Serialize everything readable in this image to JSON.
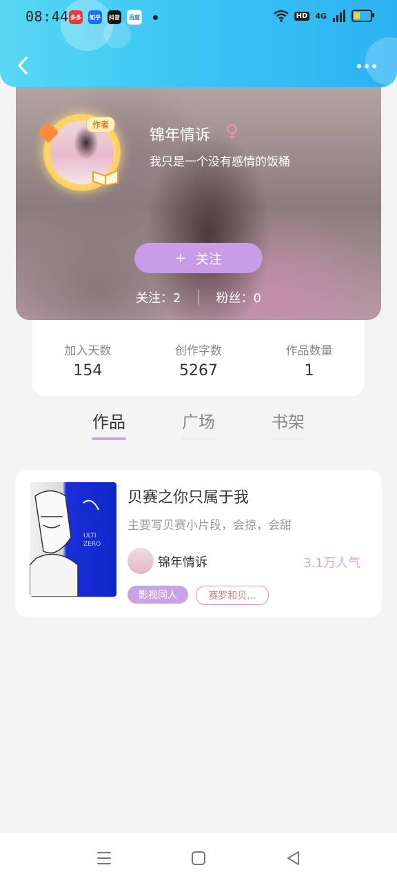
{
  "status_bar": {
    "time": "08:44",
    "notifications": [
      "多多",
      "知乎",
      "抖音",
      "百度"
    ],
    "network": "4G",
    "hd": "HD"
  },
  "header": {
    "back_icon": "chevron-left-icon",
    "more_icon": "more-horizontal-icon"
  },
  "profile": {
    "author_badge": "作者",
    "username": "锦年情诉",
    "gender_symbol": "♀",
    "bio": "我只是一个没有感情的饭桶",
    "follow_plus": "+",
    "follow_label": "关注",
    "following_label": "关注：",
    "following_count": "2",
    "fans_label": "粉丝：",
    "fans_count": "0"
  },
  "counters": [
    {
      "label": "加入天数",
      "value": "154"
    },
    {
      "label": "创作字数",
      "value": "5267"
    },
    {
      "label": "作品数量",
      "value": "1"
    }
  ],
  "tabs": [
    {
      "label": "作品",
      "active": true
    },
    {
      "label": "广场",
      "active": false
    },
    {
      "label": "书架",
      "active": false
    }
  ],
  "book": {
    "title": "贝赛之你只属于我",
    "description": "主要写贝赛小片段，会掠，会甜",
    "author": "锦年情诉",
    "popularity": "3.1万人气",
    "tags": [
      "影视同人",
      "赛罗和贝..."
    ]
  },
  "nav": {
    "menu_icon": "menu-icon",
    "home_icon": "home-square-icon",
    "back_icon": "back-triangle-icon"
  },
  "colors": {
    "header_gradient_start": "#57d8f2",
    "header_gradient_end": "#2bb2f3",
    "accent_purple": "#c79be6",
    "popularity_color": "#d6a5e6",
    "tag_outline": "#e69b98"
  }
}
